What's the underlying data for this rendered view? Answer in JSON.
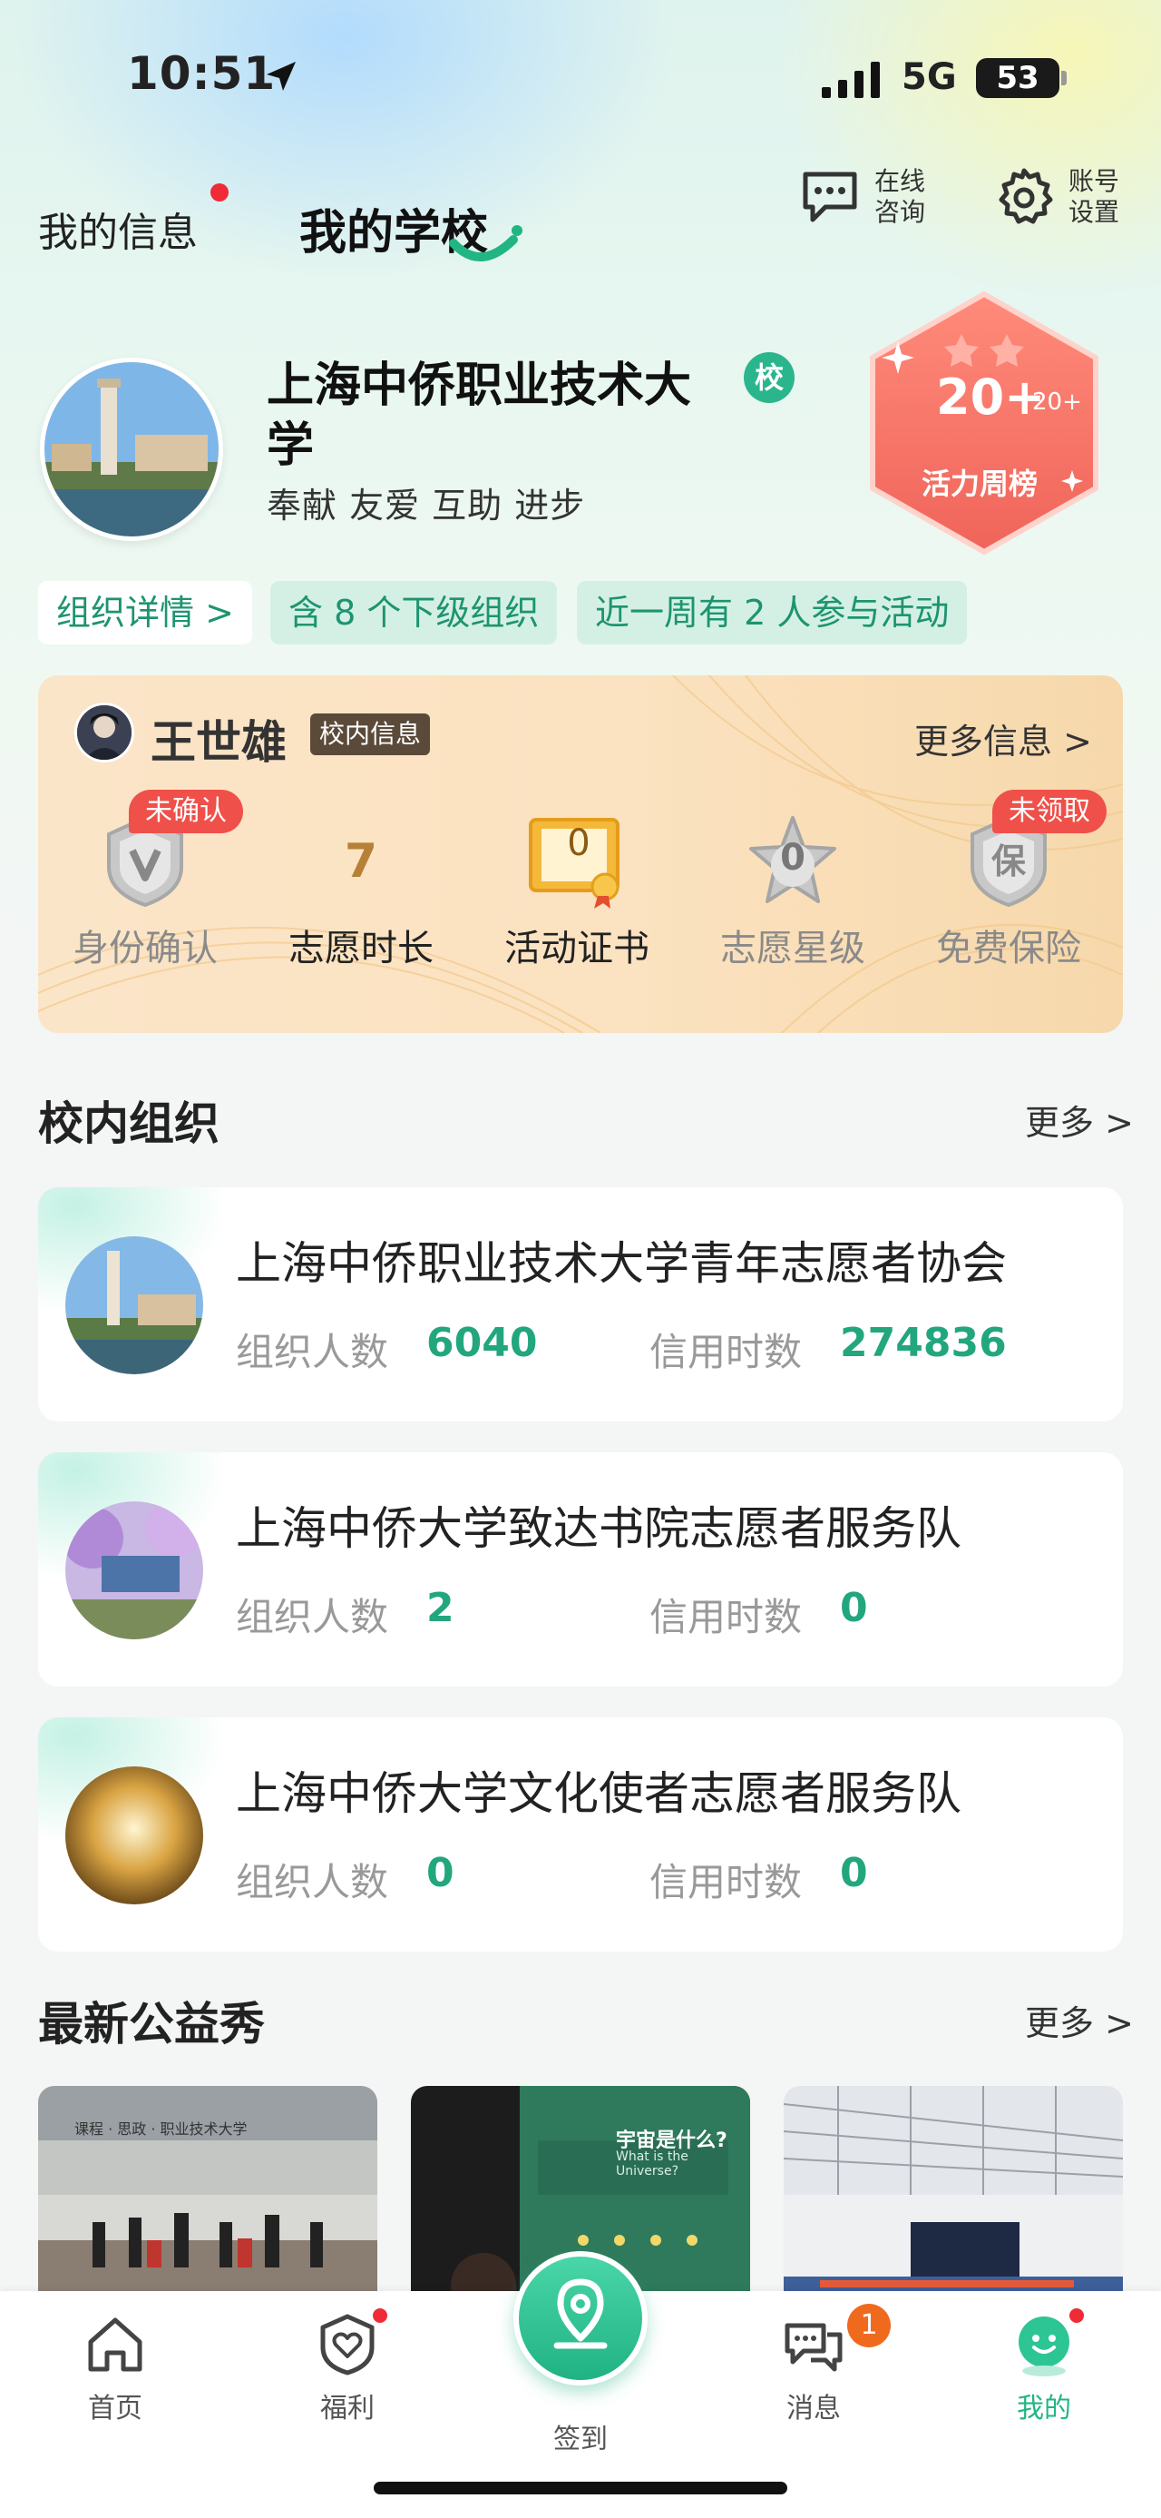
{
  "status_bar": {
    "time": "10:51",
    "network": "5G",
    "battery": "53"
  },
  "header": {
    "tab_my_info": "我的信息",
    "tab_my_school": "我的学校",
    "consult_label": "在线\n咨询",
    "account_label": "账号\n设置"
  },
  "school": {
    "name": "上海中侨职业技术大学",
    "badge": "校",
    "motto": "奉献 友爱 互助 进步",
    "activity_rank": {
      "value": "20+",
      "sub": "20+",
      "label": "活力周榜"
    },
    "chips": {
      "detail": "组织详情 >",
      "sub_orgs": "含 8 个下级组织",
      "week": "近一周有 2 人参与活动"
    }
  },
  "volunteer": {
    "name": "王世雄",
    "tag": "校内信息",
    "more": "更多信息 >",
    "items": [
      {
        "label": "身份确认",
        "badge": "未确认",
        "icon": "v-shield-icon"
      },
      {
        "label": "志愿时长",
        "value": "7"
      },
      {
        "label": "活动证书",
        "value": "0",
        "icon": "certificate-icon"
      },
      {
        "label": "志愿星级",
        "value": "0",
        "icon": "star-icon"
      },
      {
        "label": "免费保险",
        "badge": "未领取",
        "icon": "insurance-shield-icon",
        "icon_text": "保"
      }
    ]
  },
  "orgs_section": {
    "title": "校内组织",
    "more": "更多 >"
  },
  "orgs": [
    {
      "name": "上海中侨职业技术大学青年志愿者协会",
      "members_label": "组织人数",
      "members": "6040",
      "credit_label": "信用时数",
      "credit": "274836"
    },
    {
      "name": "上海中侨大学致达书院志愿者服务队",
      "members_label": "组织人数",
      "members": "2",
      "credit_label": "信用时数",
      "credit": "0"
    },
    {
      "name": "上海中侨大学文化使者志愿者服务队",
      "members_label": "组织人数",
      "members": "0",
      "credit_label": "信用时数",
      "credit": "0"
    }
  ],
  "showcase_section": {
    "title": "最新公益秀",
    "more": "更多 >"
  },
  "showcase_photos": [
    {
      "caption": "",
      "sign_text": "课程 · 思政 · 职业技术大学"
    },
    {
      "caption": "",
      "sign_text": "宇宙是什么?",
      "sign_sub": "What is the Universe?"
    },
    {
      "caption": ""
    }
  ],
  "tabbar": {
    "items": [
      {
        "label": "首页"
      },
      {
        "label": "福利"
      },
      {
        "label": "签到"
      },
      {
        "label": "消息",
        "badge": "1"
      },
      {
        "label": "我的"
      }
    ],
    "accent": "#22b584"
  }
}
